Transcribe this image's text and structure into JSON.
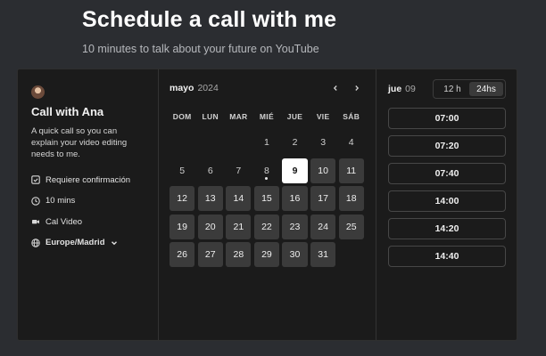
{
  "hero": {
    "title": "Schedule a call with me",
    "subtitle": "10 minutes to talk about your future on YouTube"
  },
  "event": {
    "title": "Call with Ana",
    "description": "A quick call so you can explain your video editing needs to me.",
    "confirmation": "Requiere confirmación",
    "duration": "10 mins",
    "location": "Cal Video",
    "timezone": "Europe/Madrid"
  },
  "calendar": {
    "month": "mayo",
    "year": "2024",
    "weekdays": [
      "DOM",
      "LUN",
      "MAR",
      "MIÉ",
      "JUE",
      "VIE",
      "SÁB"
    ],
    "leading_blanks": 3,
    "days": [
      "1",
      "2",
      "3",
      "4",
      "5",
      "6",
      "7",
      "8",
      "9",
      "10",
      "11",
      "12",
      "13",
      "14",
      "15",
      "16",
      "17",
      "18",
      "19",
      "20",
      "21",
      "22",
      "23",
      "24",
      "25",
      "26",
      "27",
      "28",
      "29",
      "30",
      "31"
    ],
    "today": "8",
    "selected": "9",
    "first_available": "9"
  },
  "times": {
    "day_label": "jue",
    "day_number": "09",
    "format_options": [
      "12 h",
      "24hs"
    ],
    "active_format": "24hs",
    "slots": [
      "07:00",
      "07:20",
      "07:40",
      "14:00",
      "14:20",
      "14:40"
    ]
  },
  "icons": {
    "confirm": "checkbox-icon",
    "duration": "clock-icon",
    "location": "video-camera-icon",
    "timezone": "globe-icon",
    "tz_dropdown": "chevron-down-icon",
    "prev_month": "chevron-left-icon",
    "next_month": "chevron-right-icon"
  }
}
